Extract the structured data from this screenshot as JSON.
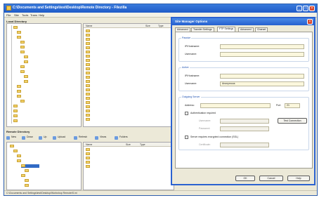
{
  "window": {
    "title": "C:\\Documents and Settings\\test\\Desktop\\Remote Directory - Filezilla",
    "min": "_",
    "max": "□",
    "close": "×"
  },
  "menu": [
    "File",
    "Site",
    "Tools",
    "Trans",
    "Help"
  ],
  "local_pane_label": "Local Directory",
  "remote_pane_label": "Remote Directory",
  "list_headers": [
    "Name",
    "Size",
    "Type"
  ],
  "toolbar": [
    "New",
    "Down",
    "Up",
    "Upload",
    "Refresh",
    "Views",
    "Folders"
  ],
  "status": "C:\\Documents and Settings\\test\\Desktop\\Workshop Remote\\S.ini",
  "dialog": {
    "title": "Site Manager Options",
    "close": "×",
    "tabs": [
      "Advanced",
      "Transfer Settings",
      "FTP Settings",
      "Advanced",
      "Charset"
    ],
    "groups": [
      {
        "label": "Passive"
      },
      {
        "label": "Active"
      },
      {
        "label": "Outgoing Server"
      }
    ],
    "fields": {
      "ip_label": "IP/Hostname:",
      "port_label": "Port",
      "ip2_label": "IP/Hostname:",
      "username_label": "Username:",
      "username_value": "Anonymous",
      "address_label": "Address:",
      "port_value": "21",
      "auth_label": "Authentication required",
      "username2_label": "Username:",
      "password_label": "Password:",
      "test_button": "Test Connection",
      "secure_label": "Server requires encrypted connection (SSL)",
      "cert_label": "Certificate:"
    },
    "buttons": {
      "ok": "OK",
      "cancel": "Cancel",
      "help": "Help"
    }
  }
}
